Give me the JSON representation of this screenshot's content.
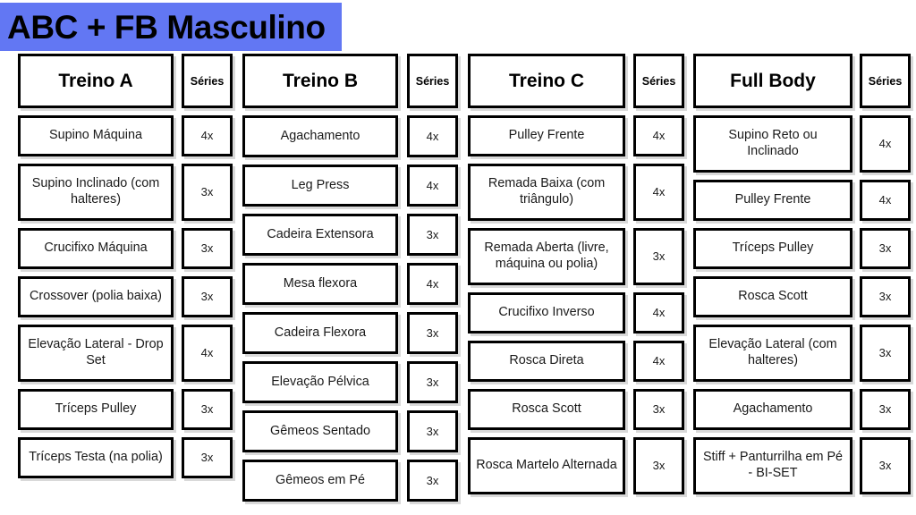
{
  "page": {
    "title": "ABC + FB Masculino",
    "accent_color": "#6277F3",
    "border_color": "#000000",
    "background_color": "#FFFFFF",
    "shadow_color": "#D9D9D9"
  },
  "series_header_label": "Séries",
  "columns": [
    {
      "id": "treino-a",
      "header": "Treino A",
      "series_header": "Séries",
      "rows": [
        {
          "exercise": "Supino Máquina",
          "series": "4x",
          "lines": 1
        },
        {
          "exercise": "Supino Inclinado (com halteres)",
          "series": "3x",
          "lines": 2
        },
        {
          "exercise": "Crucifixo Máquina",
          "series": "3x",
          "lines": 1
        },
        {
          "exercise": "Crossover (polia baixa)",
          "series": "3x",
          "lines": 1
        },
        {
          "exercise": "Elevação Lateral - Drop Set",
          "series": "4x",
          "lines": 2
        },
        {
          "exercise": "Tríceps Pulley",
          "series": "3x",
          "lines": 1
        },
        {
          "exercise": "Tríceps Testa (na polia)",
          "series": "3x",
          "lines": 1
        }
      ]
    },
    {
      "id": "treino-b",
      "header": "Treino B",
      "series_header": "Séries",
      "rows": [
        {
          "exercise": "Agachamento",
          "series": "4x",
          "lines": 1
        },
        {
          "exercise": "Leg Press",
          "series": "4x",
          "lines": 1
        },
        {
          "exercise": "Cadeira Extensora",
          "series": "3x",
          "lines": 1
        },
        {
          "exercise": "Mesa flexora",
          "series": "4x",
          "lines": 1
        },
        {
          "exercise": "Cadeira Flexora",
          "series": "3x",
          "lines": 1
        },
        {
          "exercise": "Elevação Pélvica",
          "series": "3x",
          "lines": 1
        },
        {
          "exercise": "Gêmeos Sentado",
          "series": "3x",
          "lines": 1
        },
        {
          "exercise": "Gêmeos em Pé",
          "series": "3x",
          "lines": 1
        }
      ]
    },
    {
      "id": "treino-c",
      "header": "Treino C",
      "series_header": "Séries",
      "rows": [
        {
          "exercise": "Pulley Frente",
          "series": "4x",
          "lines": 1
        },
        {
          "exercise": "Remada Baixa (com triângulo)",
          "series": "4x",
          "lines": 2
        },
        {
          "exercise": "Remada Aberta (livre, máquina ou polia)",
          "series": "3x",
          "lines": 2
        },
        {
          "exercise": "Crucifixo Inverso",
          "series": "4x",
          "lines": 1
        },
        {
          "exercise": "Rosca Direta",
          "series": "4x",
          "lines": 1
        },
        {
          "exercise": "Rosca Scott",
          "series": "3x",
          "lines": 1
        },
        {
          "exercise": "Rosca Martelo Alternada",
          "series": "3x",
          "lines": 2
        }
      ]
    },
    {
      "id": "full-body",
      "header": "Full Body",
      "series_header": "Séries",
      "rows": [
        {
          "exercise": "Supino Reto ou Inclinado",
          "series": "4x",
          "lines": 2
        },
        {
          "exercise": "Pulley Frente",
          "series": "4x",
          "lines": 1
        },
        {
          "exercise": "Tríceps Pulley",
          "series": "3x",
          "lines": 1
        },
        {
          "exercise": "Rosca Scott",
          "series": "3x",
          "lines": 1
        },
        {
          "exercise": "Elevação Lateral (com halteres)",
          "series": "3x",
          "lines": 2
        },
        {
          "exercise": "Agachamento",
          "series": "3x",
          "lines": 1
        },
        {
          "exercise": "Stiff + Panturrilha em Pé - BI-SET",
          "series": "3x",
          "lines": 2
        }
      ]
    }
  ]
}
